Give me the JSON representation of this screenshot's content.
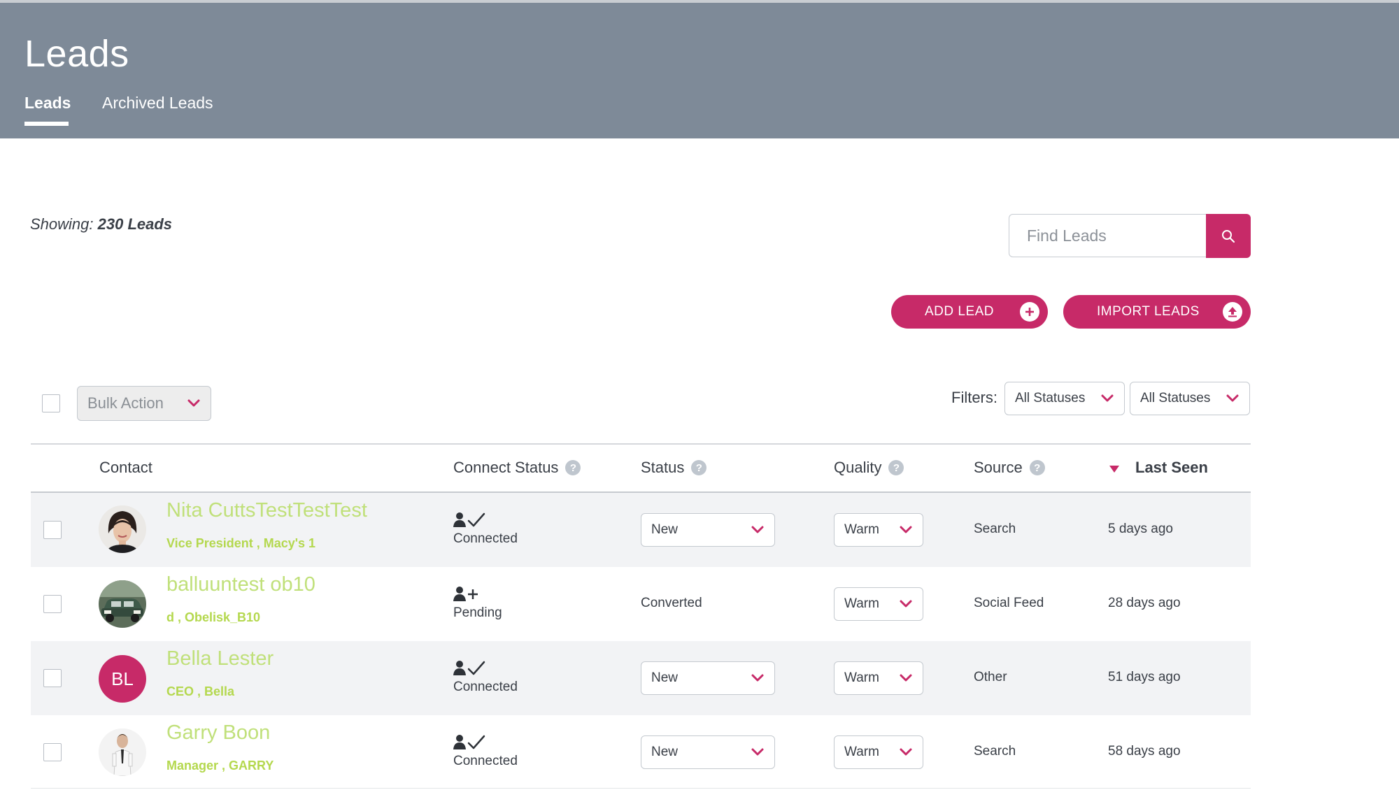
{
  "header": {
    "title": "Leads",
    "tabs": [
      {
        "label": "Leads",
        "active": true
      },
      {
        "label": "Archived Leads",
        "active": false
      }
    ]
  },
  "summary": {
    "prefix": "Showing:",
    "count_text": "230 Leads"
  },
  "search": {
    "placeholder": "Find Leads",
    "icon": "search-icon"
  },
  "actions": {
    "add_label": "ADD LEAD",
    "add_icon": "plus-circle-icon",
    "import_label": "IMPORT LEADS",
    "import_icon": "upload-circle-icon"
  },
  "toolbar": {
    "bulk_label": "Bulk Action",
    "filters_label": "Filters:",
    "filter_1": "All Statuses",
    "filter_2": "All Statuses"
  },
  "columns": {
    "contact": "Contact",
    "connect_status": "Connect Status",
    "status": "Status",
    "quality": "Quality",
    "source": "Source",
    "last_seen": "Last Seen"
  },
  "colors": {
    "header_bg": "#7e8a98",
    "accent": "#c72a68",
    "name_green": "#c0e07a",
    "sub_green": "#b4d84e"
  },
  "rows": [
    {
      "name": "Nita CuttsTestTestTest",
      "subtitle": "Vice President , Macy's 1",
      "avatar": "photo-woman",
      "connect_icon": "user-check-icon",
      "connect_text": "Connected",
      "status": "New",
      "status_is_select": true,
      "quality": "Warm",
      "source": "Search",
      "last_seen": "5 days ago"
    },
    {
      "name": "balluuntest ob10",
      "subtitle": "d , Obelisk_B10",
      "avatar": "photo-car",
      "connect_icon": "user-plus-icon",
      "connect_text": "Pending",
      "status": "Converted",
      "status_is_select": false,
      "quality": "Warm",
      "source": "Social Feed",
      "last_seen": "28 days ago"
    },
    {
      "name": "Bella Lester",
      "subtitle": "CEO , Bella",
      "avatar_initials": "BL",
      "connect_icon": "user-check-icon",
      "connect_text": "Connected",
      "status": "New",
      "status_is_select": true,
      "quality": "Warm",
      "source": "Other",
      "last_seen": "51 days ago"
    },
    {
      "name": "Garry Boon",
      "subtitle": "Manager , GARRY",
      "avatar": "photo-man",
      "connect_icon": "user-check-icon",
      "connect_text": "Connected",
      "status": "New",
      "status_is_select": true,
      "quality": "Warm",
      "source": "Search",
      "last_seen": "58 days ago"
    }
  ]
}
